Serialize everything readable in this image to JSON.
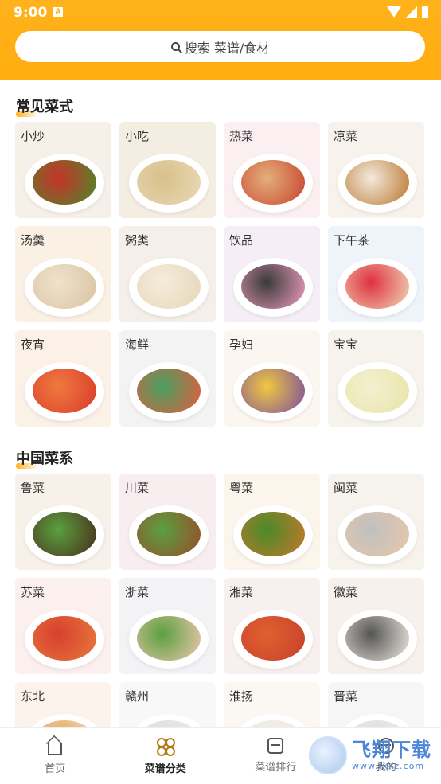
{
  "status": {
    "time": "9:00",
    "notif": "A"
  },
  "search": {
    "placeholder": "搜索 菜谱/食材"
  },
  "sections": [
    {
      "title": "常见菜式",
      "items": [
        "小炒",
        "小吃",
        "热菜",
        "凉菜",
        "汤羹",
        "粥类",
        "饮品",
        "下午茶",
        "夜宵",
        "海鲜",
        "孕妇",
        "宝宝"
      ]
    },
    {
      "title": "中国菜系",
      "items": [
        "鲁菜",
        "川菜",
        "粤菜",
        "闽菜",
        "苏菜",
        "浙菜",
        "湘菜",
        "徽菜",
        "东北",
        "赣州",
        "淮扬",
        "晋菜"
      ]
    }
  ],
  "nav": [
    {
      "label": "首页",
      "icon": "home-icon"
    },
    {
      "label": "菜谱分类",
      "icon": "category-icon"
    },
    {
      "label": "菜谱排行",
      "icon": "rank-icon"
    },
    {
      "label": "我的",
      "icon": "profile-icon"
    }
  ],
  "watermark": {
    "main": "飞翔下载",
    "sub": "www.fxxz.com"
  },
  "colors": {
    "accent": "#ffb21b"
  }
}
